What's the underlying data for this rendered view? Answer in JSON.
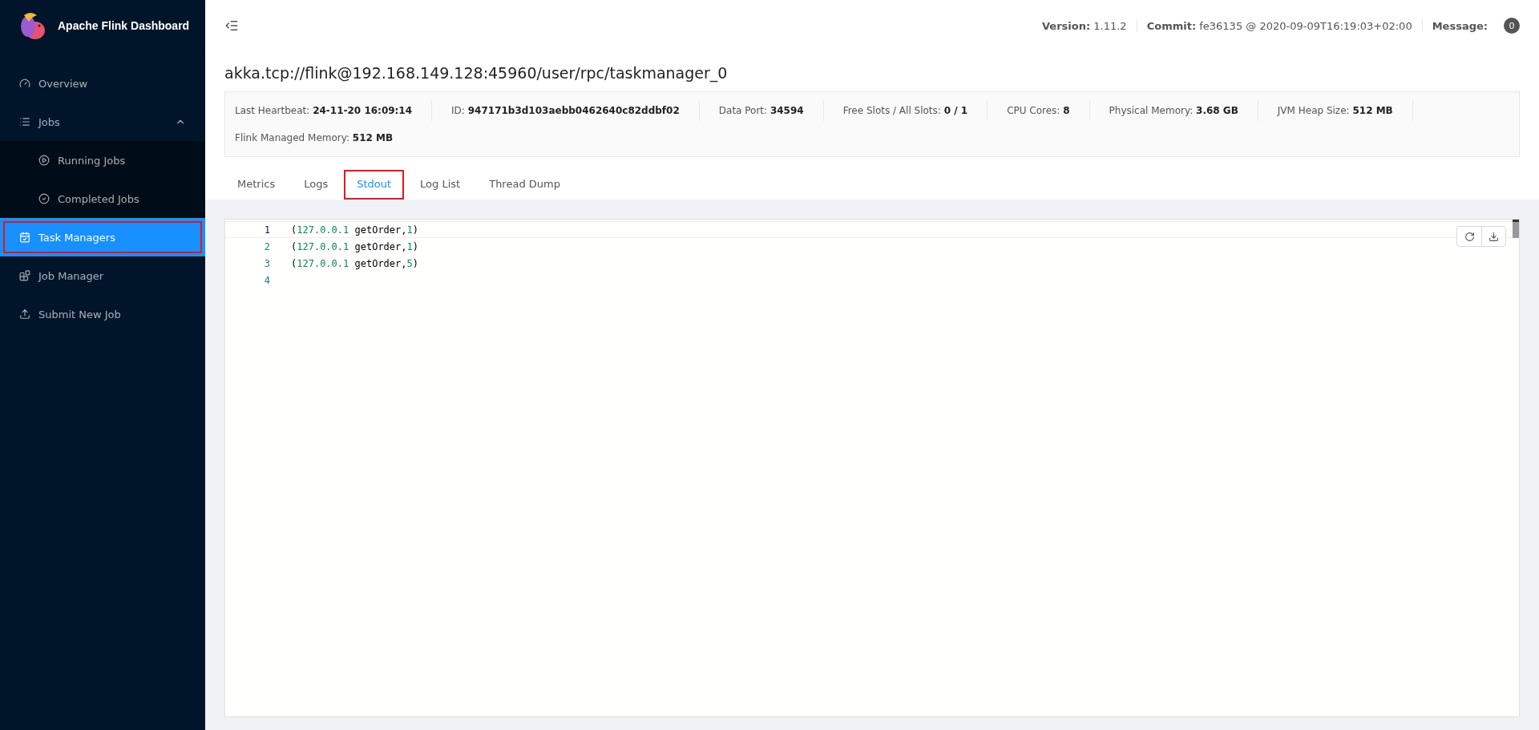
{
  "brand": {
    "title": "Apache Flink Dashboard"
  },
  "sidebar": {
    "items": [
      {
        "label": "Overview",
        "kind": "gauge",
        "selected": false,
        "outlined": false
      },
      {
        "label": "Jobs",
        "kind": "list",
        "selected": false,
        "outlined": false,
        "expanded": true,
        "children": [
          {
            "label": "Running Jobs",
            "kind": "play",
            "selected": false,
            "outlined": false
          },
          {
            "label": "Completed Jobs",
            "kind": "check",
            "selected": false,
            "outlined": false
          }
        ]
      },
      {
        "label": "Task Managers",
        "kind": "calendar",
        "selected": true,
        "outlined": true
      },
      {
        "label": "Job Manager",
        "kind": "blocks",
        "selected": false,
        "outlined": false
      },
      {
        "label": "Submit New Job",
        "kind": "upload",
        "selected": false,
        "outlined": false
      }
    ]
  },
  "header": {
    "items": [
      {
        "label": "Version:",
        "value": "1.11.2"
      },
      {
        "label": "Commit:",
        "value": "fe36135 @ 2020-09-09T16:19:03+02:00"
      }
    ],
    "message": {
      "label": "Message:",
      "count": "0"
    }
  },
  "page_title": "akka.tcp://flink@192.168.149.128:45960/user/rpc/taskmanager_0",
  "info": [
    {
      "label": "Last Heartbeat:",
      "value": "24-11-20 16:09:14"
    },
    {
      "label": "ID:",
      "value": "947171b3d103aebb0462640c82ddbf02"
    },
    {
      "label": "Data Port:",
      "value": "34594"
    },
    {
      "label": "Free Slots / All Slots:",
      "value": "0 / 1"
    },
    {
      "label": "CPU Cores:",
      "value": "8"
    },
    {
      "label": "Physical Memory:",
      "value": "3.68 GB"
    },
    {
      "label": "JVM Heap Size:",
      "value": "512 MB"
    },
    {
      "label": "Flink Managed Memory:",
      "value": "512 MB"
    }
  ],
  "tabs": [
    {
      "label": "Metrics",
      "selected": false,
      "outlined": false
    },
    {
      "label": "Logs",
      "selected": false,
      "outlined": false
    },
    {
      "label": "Stdout",
      "selected": true,
      "outlined": true
    },
    {
      "label": "Log List",
      "selected": false,
      "outlined": false
    },
    {
      "label": "Thread Dump",
      "selected": false,
      "outlined": false
    }
  ],
  "editor": {
    "lines": [
      {
        "number": "1",
        "text": "(127.0.0.1 getOrder,1)",
        "selected": true
      },
      {
        "number": "2",
        "text": "(127.0.0.1 getOrder,1)",
        "selected": false
      },
      {
        "number": "3",
        "text": "(127.0.0.1 getOrder,5)",
        "selected": false
      },
      {
        "number": "4",
        "selected": false
      }
    ]
  }
}
